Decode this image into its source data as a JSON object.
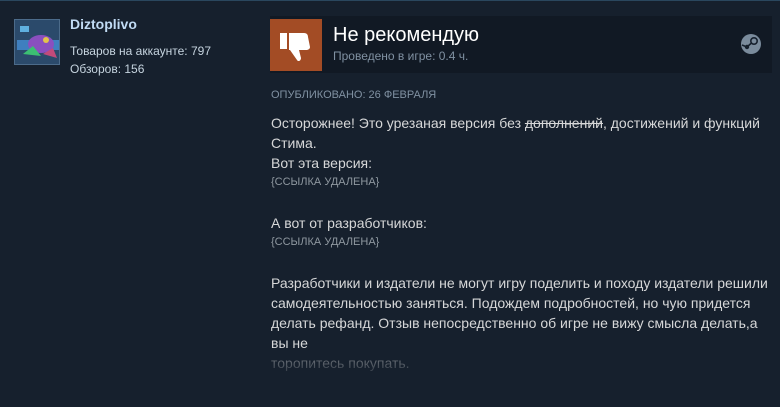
{
  "author": {
    "name": "Diztoplivo",
    "products_text": "Товаров на аккаунте: 797",
    "reviews_text": "Обзоров: 156"
  },
  "vote": {
    "title": "Не рекомендую",
    "hours": "Проведено в игре: 0.4 ч.",
    "icon": "thumbs-down-icon",
    "platform_icon": "steam-icon"
  },
  "posted": "Опубликовано: 26 февраля",
  "review": {
    "p1_before": "Осторожнее! Это урезаная версия без ",
    "p1_strike": "дополнений",
    "p1_after": ", достижений и функций Стима.",
    "p2": "Вот эта версия:",
    "link1": "{ССЫЛКА УДАЛЕНА}",
    "p3": "А вот от разработчиков:",
    "link2": "{ССЫЛКА УДАЛЕНА}",
    "p4": "Разработчики и издатели не могут игру поделить и походу издатели решили самодеятельностью заняться. Подождем подробностей, но чую придется делать рефанд. Отзыв непосредственно об игре не вижу смысла делать,а вы не",
    "p4_fade": "торопитесь покупать."
  },
  "colors": {
    "background": "#1b2838",
    "card": "#16202d",
    "thumb_bg": "#a34c25",
    "author_name": "#c1dbf4",
    "muted": "#8091a2"
  }
}
